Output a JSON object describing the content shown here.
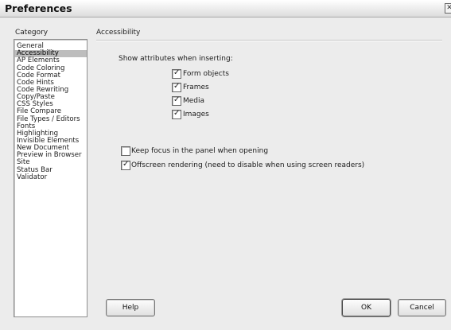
{
  "window": {
    "title": "Preferences",
    "close_glyph": "✕"
  },
  "category_header": "Category",
  "section_header": "Accessibility",
  "categories": [
    "General",
    "Accessibility",
    "AP Elements",
    "Code Coloring",
    "Code Format",
    "Code Hints",
    "Code Rewriting",
    "Copy/Paste",
    "CSS Styles",
    "File Compare",
    "File Types / Editors",
    "Fonts",
    "Highlighting",
    "Invisible Elements",
    "New Document",
    "Preview in Browser",
    "Site",
    "Status Bar",
    "Validator"
  ],
  "selected_category": "Accessibility",
  "show_attributes_label": "Show attributes when inserting:",
  "attributes": [
    {
      "label": "Form objects",
      "checked": true
    },
    {
      "label": "Frames",
      "checked": true
    },
    {
      "label": "Media",
      "checked": true
    },
    {
      "label": "Images",
      "checked": true
    }
  ],
  "options": [
    {
      "label": "Keep focus in the panel when opening",
      "checked": false
    },
    {
      "label": "Offscreen rendering (need to disable when using screen readers)",
      "checked": true
    }
  ],
  "buttons": {
    "help": "Help",
    "ok": "OK",
    "cancel": "Cancel"
  },
  "check_glyph": "✓"
}
